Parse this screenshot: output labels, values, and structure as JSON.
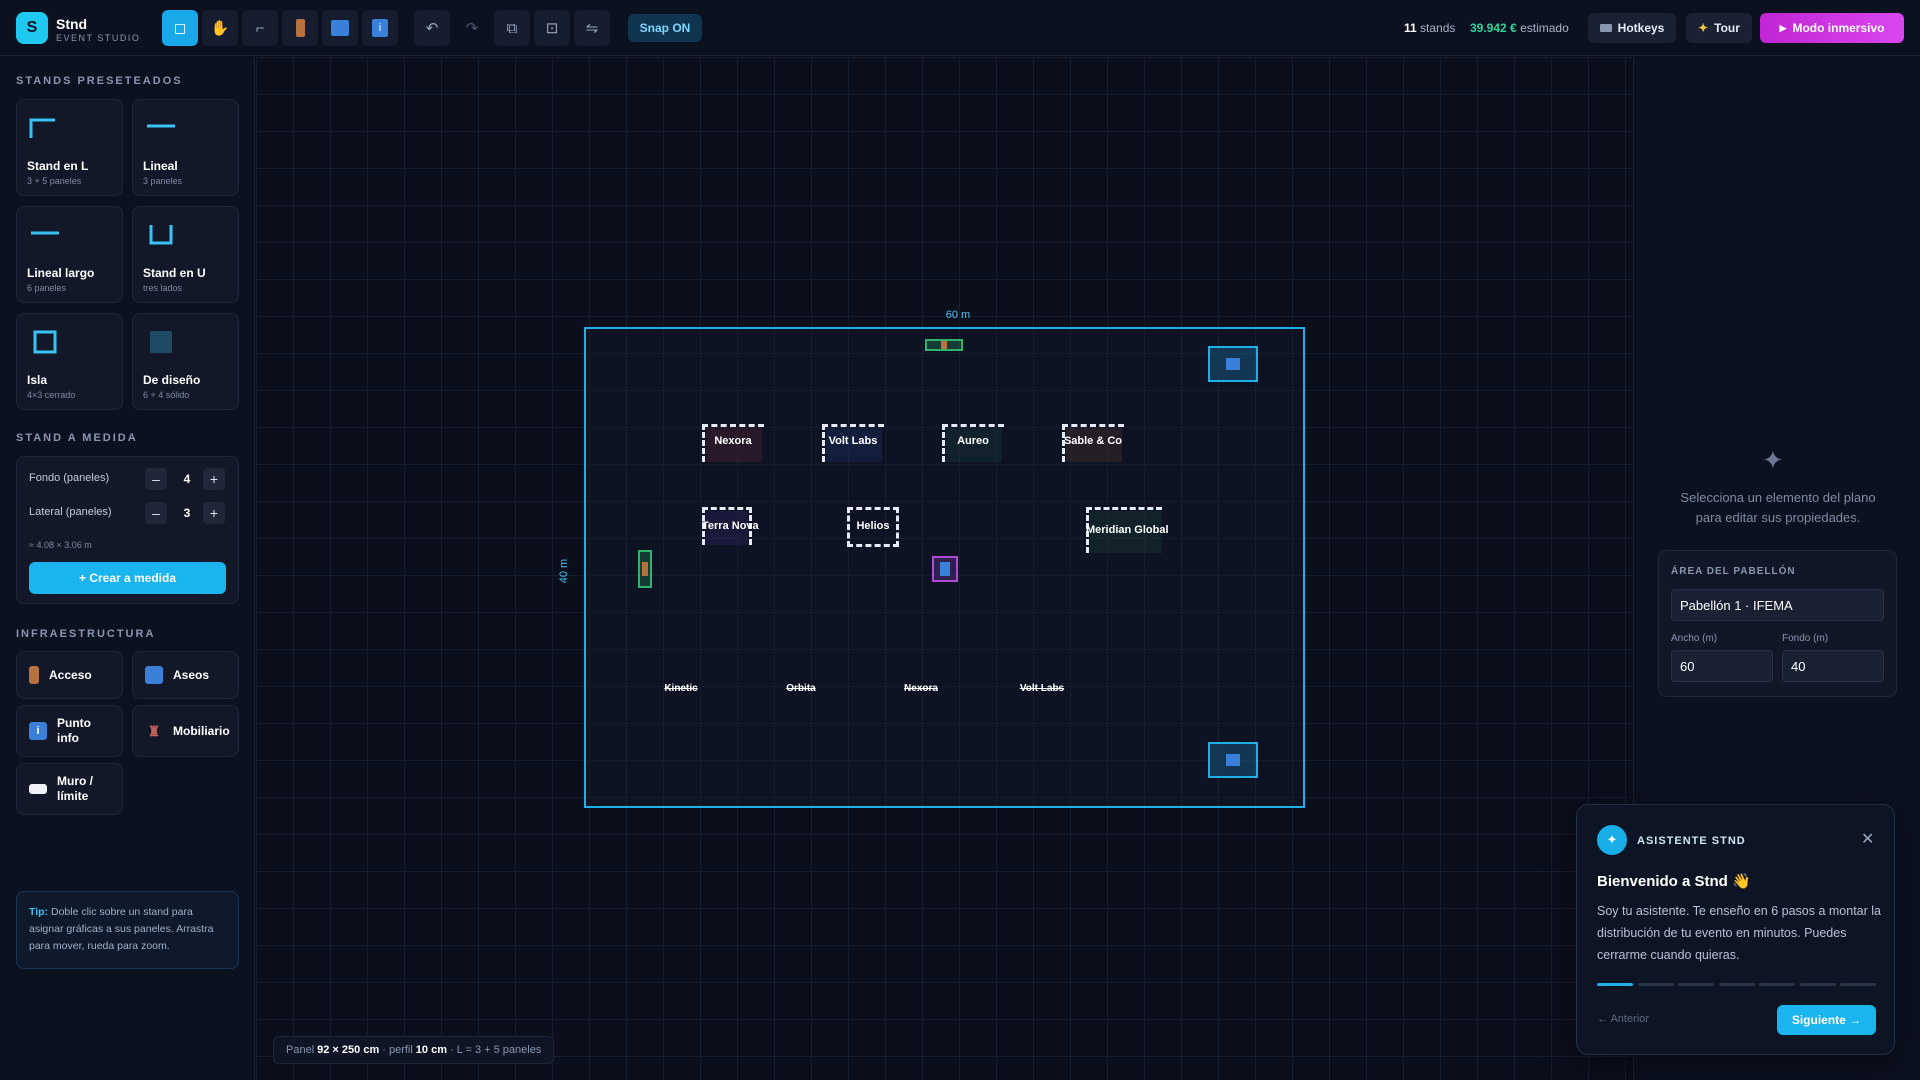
{
  "app": {
    "logo_letter": "S",
    "name": "Stnd",
    "subtitle": "EVENT STUDIO"
  },
  "toolbar": {
    "tools": [
      {
        "name": "select-tool",
        "glyph": "◻"
      },
      {
        "name": "pan-tool",
        "glyph": "✋"
      },
      {
        "name": "corner-tool",
        "glyph": "⌐"
      },
      {
        "name": "door-tool",
        "glyph": "▮"
      },
      {
        "name": "restroom-tool",
        "glyph": "🚻"
      },
      {
        "name": "info-tool",
        "glyph": "i"
      },
      {
        "name": "undo-icon",
        "glyph": "↶"
      },
      {
        "name": "redo-icon",
        "glyph": "↷"
      },
      {
        "name": "duplicate-icon",
        "glyph": "⧉"
      },
      {
        "name": "center-icon",
        "glyph": "⊡"
      },
      {
        "name": "swap-icon",
        "glyph": "⇋"
      }
    ],
    "snap_label": "Snap ON"
  },
  "stats": {
    "stands_count": "11",
    "stands_label": "stands",
    "cost": "39.942 €",
    "cost_label": "estimado"
  },
  "header_buttons": {
    "hotkeys": "Hotkeys",
    "tour": "Tour",
    "immersive": "Modo inmersivo",
    "hotkeys_icon": "keyboard-icon",
    "tour_icon": "sparkle-icon",
    "immersive_icon": "play-icon"
  },
  "sidebar": {
    "presets_title": "STANDS PRESETEADOS",
    "presets": [
      {
        "name": "Stand en L",
        "sub": "3 + 5 paneles",
        "icon": "l-shape-icon"
      },
      {
        "name": "Lineal",
        "sub": "3 paneles",
        "icon": "line-icon"
      },
      {
        "name": "Lineal largo",
        "sub": "6 paneles",
        "icon": "long-line-icon"
      },
      {
        "name": "Stand en U",
        "sub": "tres lados",
        "icon": "u-shape-icon"
      },
      {
        "name": "Isla",
        "sub": "4×3 cerrado",
        "icon": "square-icon"
      },
      {
        "name": "De diseño",
        "sub": "6 + 4 sólido",
        "icon": "solid-square-icon"
      }
    ],
    "custom_title": "STAND A MEDIDA",
    "custom": {
      "fondo_label": "Fondo (paneles)",
      "fondo_value": "4",
      "lateral_label": "Lateral (paneles)",
      "lateral_value": "3",
      "dims": "≈ 4.08 × 3.06 m",
      "create_label": "+ Crear a medida",
      "minus": "–",
      "plus": "+"
    },
    "infra_title": "INFRAESTRUCTURA",
    "infra": [
      {
        "label": "Acceso",
        "icon": "door-icon"
      },
      {
        "label": "Aseos",
        "icon": "restroom-icon"
      },
      {
        "label": "Punto info",
        "icon": "info-icon"
      },
      {
        "label": "Mobiliario",
        "icon": "chair-icon"
      },
      {
        "label": "Muro / límite",
        "icon": "wall-icon"
      }
    ],
    "tip_label": "Tip:",
    "tip_text": " Doble clic sobre un stand para asignar gráficas a sus paneles. Arrastra para mover, rueda para zoom."
  },
  "canvas": {
    "width_label": "60 m",
    "depth_label": "40 m",
    "stands": [
      "Nexora",
      "Volt Labs",
      "Aureo",
      "Sable & Co",
      "Terra Nova",
      "Helios",
      "Meridian Global"
    ],
    "line_stands": [
      "Kinetic",
      "Orbita",
      "Nexora",
      "Volt Labs"
    ],
    "colors": {
      "pavilion_border": "#1eaee8",
      "accent": "#1ab4ee",
      "cost": "#2fd49a",
      "immersive": "#d946ef"
    }
  },
  "panel_info": {
    "prefix": "Panel",
    "size": "92 × 250 cm",
    "mid": "· perfil",
    "profile": "10 cm",
    "suffix": "· L = 3 + 5 paneles"
  },
  "right_panel": {
    "placeholder": "Selecciona un elemento del plano para editar sus propiedades.",
    "area_title": "ÁREA DEL PABELLÓN",
    "pavilion_name": "Pabellón 1 · IFEMA",
    "width_label": "Ancho (m)",
    "width_value": "60",
    "depth_label": "Fondo (m)",
    "depth_value": "40"
  },
  "assistant": {
    "title": "ASISTENTE STND",
    "heading": "Bienvenido a Stnd 👋",
    "body": "Soy tu asistente. Te enseño en 6 pasos a montar la distribución de tu evento en minutos. Puedes cerrarme cuando quieras.",
    "prev": "← Anterior",
    "next": "Siguiente →",
    "step": 1,
    "steps_total": 7
  }
}
